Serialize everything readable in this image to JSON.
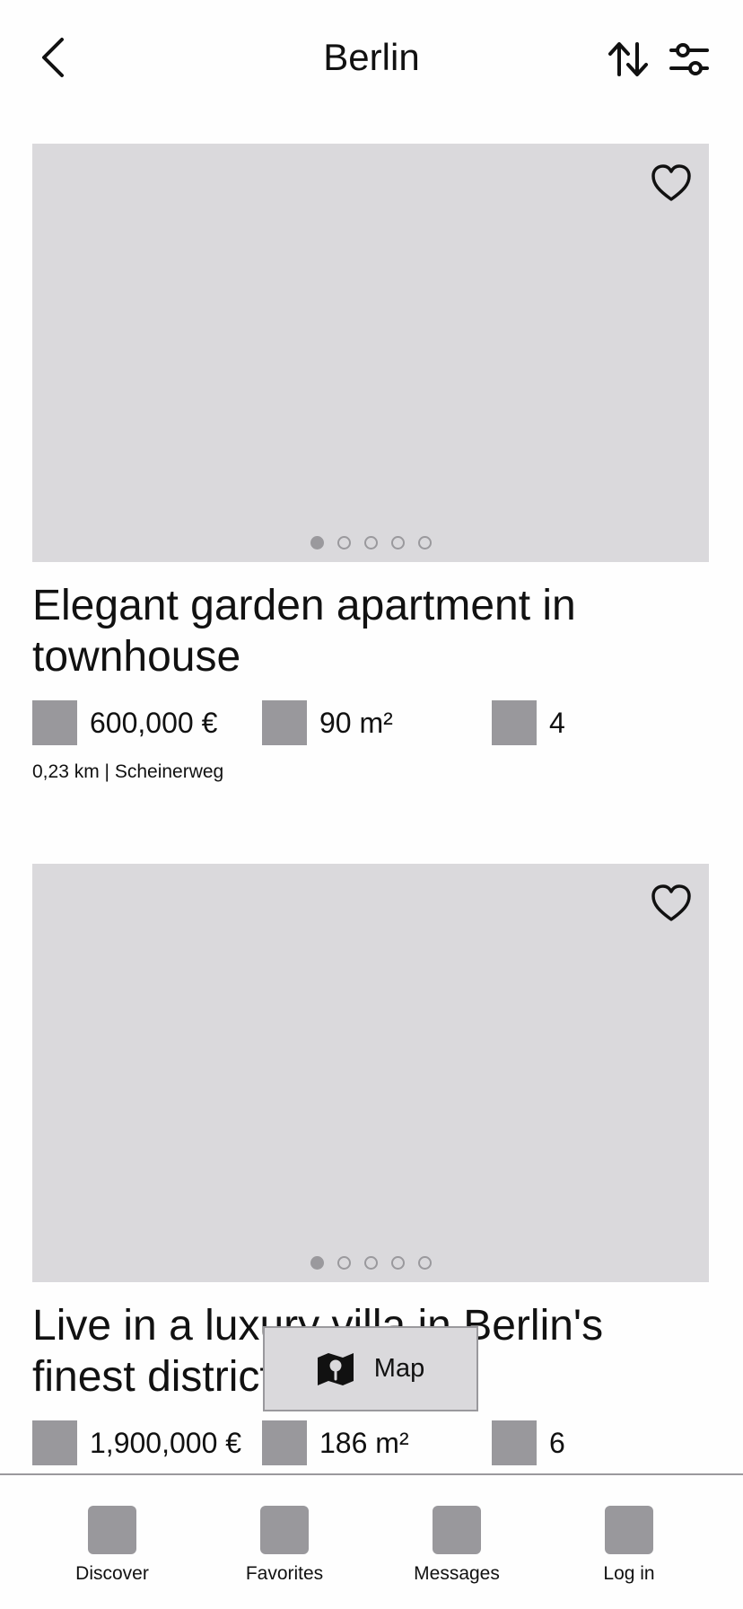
{
  "header": {
    "title": "Berlin",
    "back_icon": "chevron-left-icon",
    "sort_icon": "sort-arrows-icon",
    "filter_icon": "sliders-icon"
  },
  "listings": [
    {
      "title": "Elegant garden apartment in townhouse",
      "price": "600,000 €",
      "area": "90 m²",
      "rooms": "4",
      "meta": "0,23 km | Scheinerweg",
      "photo_count": 5,
      "active_photo": 1
    },
    {
      "title": "Live in a luxury villa in Berlin's finest district",
      "price": "1,900,000 €",
      "area": "186 m²",
      "rooms": "6",
      "photo_count": 5,
      "active_photo": 1
    }
  ],
  "map_button": {
    "label": "Map",
    "icon": "map-pin-icon"
  },
  "tabbar": {
    "items": [
      {
        "label": "Discover"
      },
      {
        "label": "Favorites"
      },
      {
        "label": "Messages"
      },
      {
        "label": "Log in"
      }
    ]
  },
  "colors": {
    "placeholder": "#dad9dc",
    "icon_placeholder": "#99989c",
    "text": "#111111"
  }
}
